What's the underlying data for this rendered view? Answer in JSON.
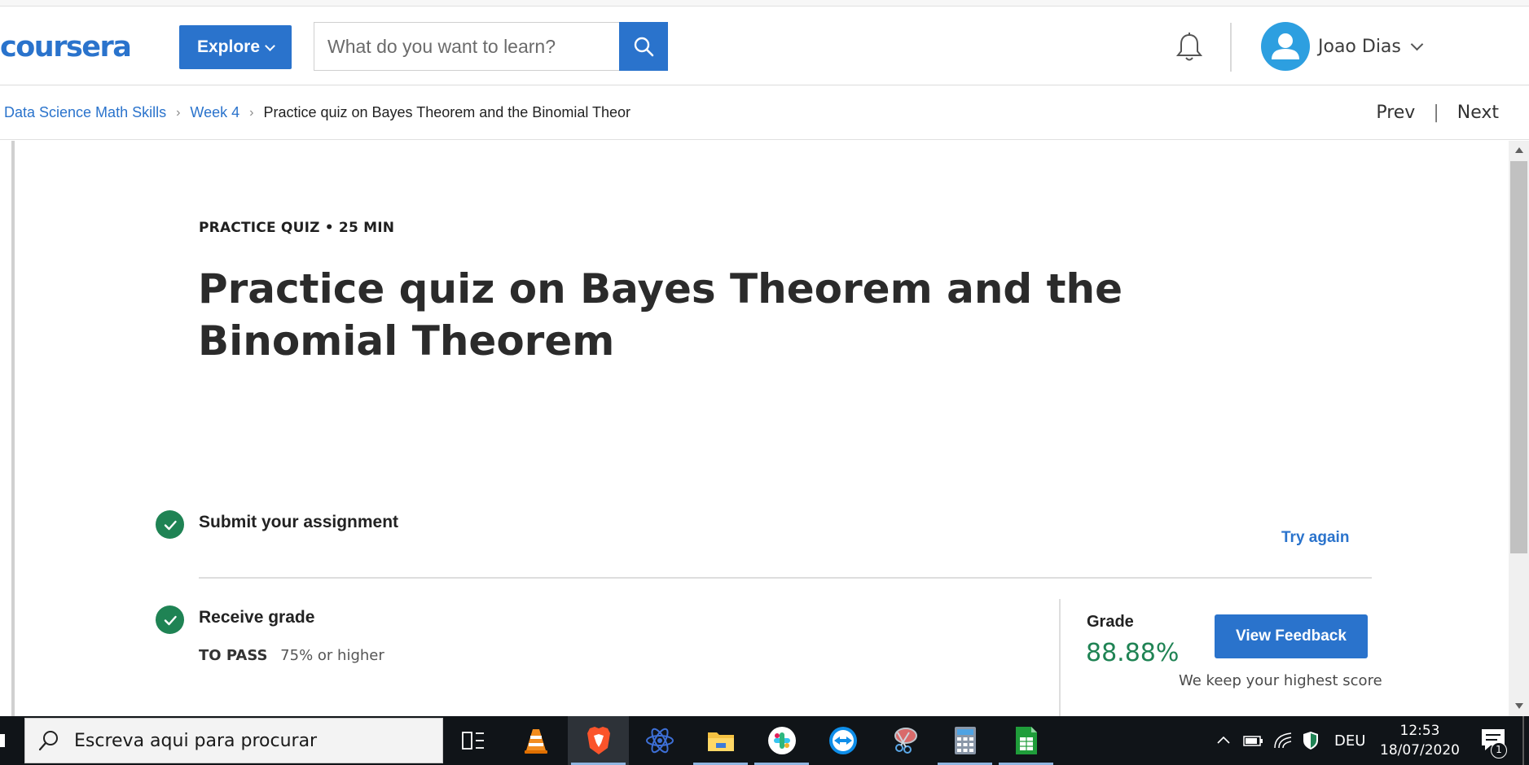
{
  "header": {
    "logo_text": "coursera",
    "explore_label": "Explore",
    "search_placeholder": "What do you want to learn?",
    "user_name": "Joao Dias",
    "brand_color": "#2a73cc"
  },
  "breadcrumb": {
    "items": [
      "Data Science Math Skills",
      "Week 4"
    ],
    "current": "Practice quiz on Bayes Theorem and the Binomial Theor",
    "prev_label": "Prev",
    "separator": "|",
    "next_label": "Next"
  },
  "quiz": {
    "meta": "PRACTICE QUIZ • 25 MIN",
    "title": "Practice quiz on Bayes Theorem and the Binomial Theorem",
    "step_submit": "Submit your assignment",
    "try_again": "Try again",
    "step_grade": "Receive grade",
    "to_pass_label": "TO PASS",
    "to_pass_value": "75% or higher",
    "grade_label": "Grade",
    "grade_value": "88.88%",
    "view_feedback": "View Feedback",
    "highest_note": "We keep your highest score",
    "success_color": "#1f8354"
  },
  "taskbar": {
    "search_placeholder": "Escreva aqui para procurar",
    "apps": [
      "task-view",
      "vlc",
      "brave",
      "atom",
      "file-explorer",
      "slack",
      "teamviewer",
      "snipping-tool",
      "calculator",
      "spreadsheet"
    ],
    "language": "DEU",
    "time": "12:53",
    "date": "18/07/2020",
    "notification_count": "1"
  }
}
